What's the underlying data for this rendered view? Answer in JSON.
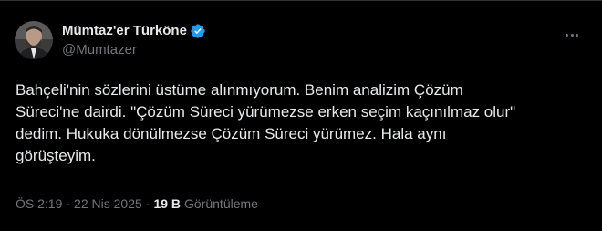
{
  "tweet": {
    "author": {
      "display_name": "Mümtaz'er Türköne",
      "handle": "@Mumtazer",
      "verified": true,
      "verified_color": "#1d9bf0"
    },
    "more_icon": "more-horizontal-icon",
    "text_lines": [
      "Bahçeli'nin sözlerini üstüme alınmıyorum. Benim analizim Çözüm",
      "Süreci'ne dairdi. \"Çözüm Süreci yürümezse erken seçim kaçınılmaz olur\"",
      "dedim. Hukuka dönülmezse Çözüm Süreci yürümez. Hala aynı",
      "görüşteyim."
    ],
    "meta": {
      "time": "ÖS 2:19",
      "separator": "·",
      "date": "22 Nis 2025",
      "views_count": "19 B",
      "views_label": "Görüntüleme"
    }
  },
  "colors": {
    "background": "#000000",
    "text_primary": "#e7e9ea",
    "text_secondary": "#71767b",
    "accent": "#1d9bf0"
  }
}
